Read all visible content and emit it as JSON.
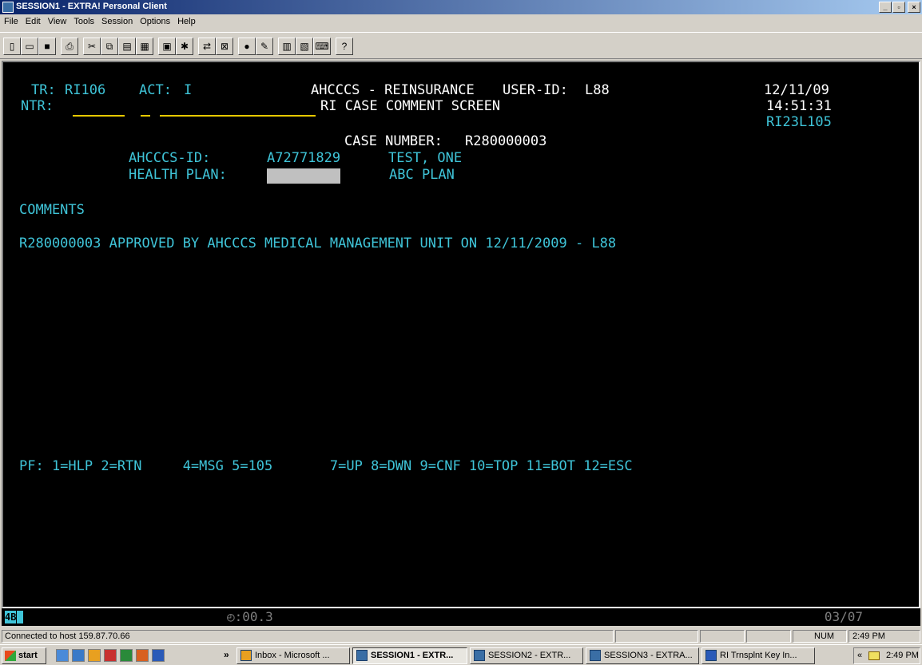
{
  "window": {
    "title": "SESSION1 - EXTRA! Personal Client",
    "controls": {
      "minimize": "_",
      "maximize": "▫",
      "close": "×"
    }
  },
  "menu": [
    "File",
    "Edit",
    "View",
    "Tools",
    "Session",
    "Options",
    "Help"
  ],
  "toolbar": {
    "buttons": [
      "new-icon",
      "open-icon",
      "save-icon",
      "print-icon",
      "cut-icon",
      "copy-icon",
      "paste-icon",
      "cell-icon",
      "open-session-icon",
      "macro-icon",
      "transfer-icon",
      "close-session-icon",
      "record-icon",
      "macro-edit-icon",
      "quickpad-icon",
      "toolbox-icon",
      "keyboard-icon",
      "help-icon"
    ]
  },
  "terminal": {
    "tr_label": "TR:",
    "tr_value": "RI106",
    "act_label": "ACT:",
    "act_value": "I",
    "system_name": "AHCCCS - REINSURANCE",
    "userid_label": "USER-ID:",
    "userid_value": "L88",
    "date": "12/11/09",
    "ntr_label": "NTR:",
    "screen_title": "RI CASE COMMENT SCREEN",
    "time": "14:51:31",
    "screen_id": "RI23L105",
    "case_number_label": "CASE NUMBER:",
    "case_number_value": "R280000003",
    "ahcccs_id_label": "AHCCCS-ID:",
    "ahcccs_id_value": "A72771829",
    "member_name": "TEST, ONE",
    "health_plan_label": "HEALTH PLAN:",
    "health_plan_name": "ABC PLAN",
    "comments_heading": "COMMENTS",
    "comment_lines": [
      "R280000003 APPROVED BY AHCCCS MEDICAL MANAGEMENT UNIT ON 12/11/2009 - L88"
    ],
    "pf_keys": "PF: 1=HLP 2=RTN     4=MSG 5=105       7=UP 8=DWN 9=CNF 10=TOP 11=BOT 12=ESC"
  },
  "oia": {
    "indicator": "4B",
    "timer": "◴:00.3",
    "cursor_position": "03/07"
  },
  "status": {
    "connection": "Connected to host 159.87.70.66",
    "num": "NUM",
    "clock": "2:49 PM"
  },
  "taskbar": {
    "start": "start",
    "quick_launch": [
      "ie-icon",
      "outlook-icon",
      "firefox-icon",
      "acrobat-icon",
      "excel-icon",
      "powerpoint-icon",
      "word-icon"
    ],
    "overflow": "»",
    "tasks": [
      {
        "label": "Inbox - Microsoft ...",
        "active": false
      },
      {
        "label": "SESSION1 - EXTR...",
        "active": true
      },
      {
        "label": "SESSION2 - EXTR...",
        "active": false
      },
      {
        "label": "SESSION3 - EXTRA...",
        "active": false
      },
      {
        "label": "RI Trnsplnt Key In...",
        "active": false
      }
    ],
    "tray_arrows": "«",
    "tray_clock": "2:49 PM"
  }
}
